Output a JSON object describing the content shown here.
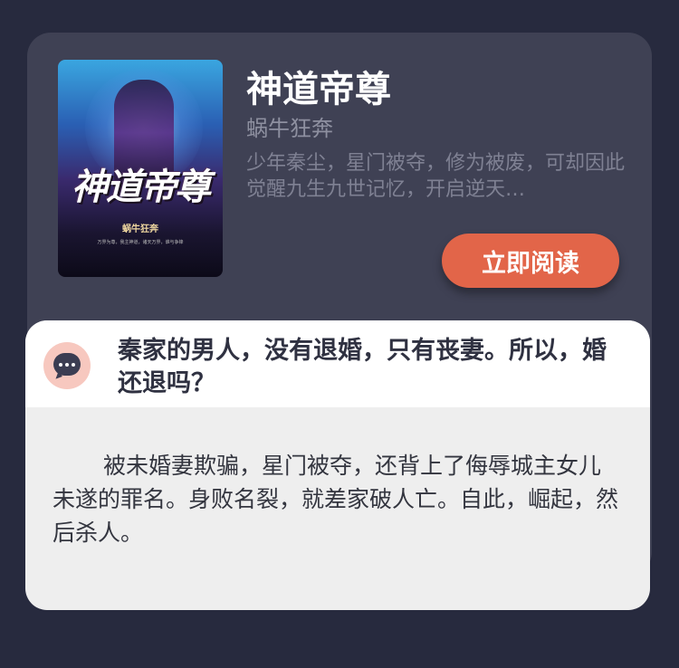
{
  "book": {
    "title": "神道帝尊",
    "author": "蜗牛狂奔",
    "description": "少年秦尘，星门被夺，修为被废，可却因此觉醒九生九世记忆，开启逆天…",
    "read_button_label": "立即阅读",
    "cover": {
      "title_text": "神道帝尊",
      "author_text": "蜗牛狂奔",
      "tagline_text": "万界为尊，我主神道，诸天万界，谁与争锋"
    }
  },
  "quote": {
    "headline": "秦家的男人，没有退婚，只有丧妻。所以，婚还退吗？",
    "body": "被未婚妻欺骗，星门被夺，还背上了侮辱城主女儿未遂的罪名。身败名裂，就差家破人亡。自此，崛起，然后杀人。"
  },
  "colors": {
    "page_background": "#272a3e",
    "card_background": "#3f4154",
    "accent": "#e26549",
    "quote_icon_bg": "#f7c8bf"
  },
  "icons": {
    "quote_icon": "chat-bubble-icon"
  }
}
